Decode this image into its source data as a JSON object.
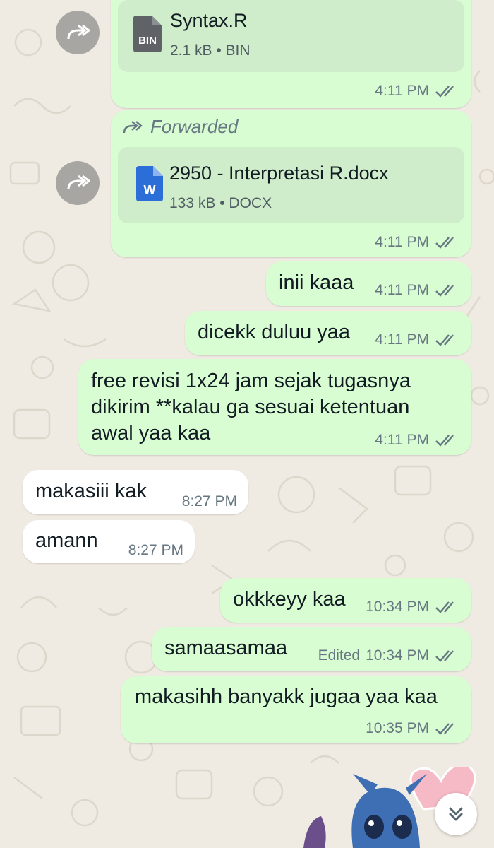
{
  "messages": [
    {
      "type": "document",
      "forwarded_label": "",
      "file_name": "Syntax.R",
      "file_info": "2.1 kB • BIN",
      "file_icon": "BIN",
      "time": "4:11 PM",
      "status": "read"
    },
    {
      "type": "document",
      "forwarded_label": "Forwarded",
      "file_name": "2950 - Interpretasi R.docx",
      "file_info": "133 kB • DOCX",
      "file_icon": "W",
      "time": "4:11 PM",
      "status": "read"
    },
    {
      "type": "text",
      "direction": "out",
      "text": "inii kaaa",
      "time": "4:11 PM",
      "status": "read"
    },
    {
      "type": "text",
      "direction": "out",
      "text": "dicekk duluu yaa",
      "time": "4:11 PM",
      "status": "read"
    },
    {
      "type": "text",
      "direction": "out",
      "lines": [
        "free revisi 1x24 jam sejak tugasnya",
        "dikirim **kalau ga sesuai ketentuan",
        "awal yaa kaa"
      ],
      "time": "4:11 PM",
      "status": "read"
    },
    {
      "type": "text",
      "direction": "in",
      "text": "makasiii kak",
      "time": "8:27 PM"
    },
    {
      "type": "text",
      "direction": "in",
      "text": "amann",
      "time": "8:27 PM"
    },
    {
      "type": "text",
      "direction": "out",
      "text": "okkkeyy kaa",
      "time": "10:34 PM",
      "status": "read"
    },
    {
      "type": "text",
      "direction": "out",
      "text": "samaasamaa",
      "edited_label": "Edited",
      "time": "10:34 PM",
      "status": "read"
    },
    {
      "type": "text",
      "direction": "out",
      "text": "makasihh banyakk jugaa yaa kaa",
      "time": "10:35 PM",
      "status": "read"
    }
  ],
  "icons": {
    "forward": "forward-icon",
    "read_receipt": "double-check-icon",
    "scroll_down": "chevron-double-down-icon",
    "bin_file": "bin-file-icon",
    "word_file": "word-file-icon"
  },
  "colors": {
    "outgoing_bubble": "#d9fdd3",
    "incoming_bubble": "#ffffff",
    "background": "#efeae2",
    "meta_text": "#667781",
    "word_icon": "#2b6ed8",
    "bin_icon": "#5f6368"
  }
}
